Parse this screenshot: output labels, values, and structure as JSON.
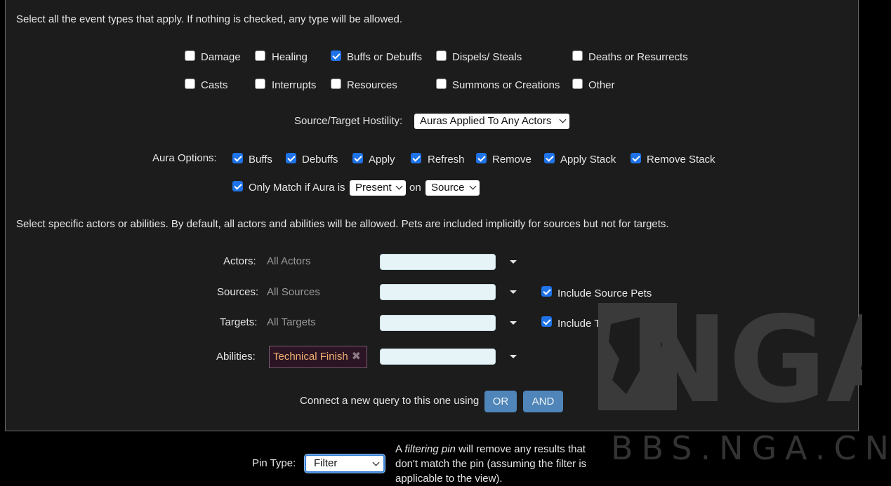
{
  "intro_text": "Select all the event types that apply. If nothing is checked, any type will be allowed.",
  "event_types": [
    {
      "label": "Damage",
      "checked": false
    },
    {
      "label": "Healing",
      "checked": false
    },
    {
      "label": "Buffs or Debuffs",
      "checked": true
    },
    {
      "label": "Dispels/ Steals",
      "checked": false
    },
    {
      "label": "Deaths or Resurrects",
      "checked": false
    },
    {
      "label": "Casts",
      "checked": false
    },
    {
      "label": "Interrupts",
      "checked": false
    },
    {
      "label": "Resources",
      "checked": false
    },
    {
      "label": "Summons or Creations",
      "checked": false
    },
    {
      "label": "Other",
      "checked": false
    }
  ],
  "hostility": {
    "label": "Source/Target Hostility:",
    "value": "Auras Applied To Any Actors"
  },
  "aura_options": {
    "label": "Aura Options:",
    "items": [
      {
        "label": "Buffs",
        "checked": true
      },
      {
        "label": "Debuffs",
        "checked": true
      },
      {
        "label": "Apply",
        "checked": true
      },
      {
        "label": "Refresh",
        "checked": true
      },
      {
        "label": "Remove",
        "checked": true
      },
      {
        "label": "Apply Stack",
        "checked": true
      },
      {
        "label": "Remove Stack",
        "checked": true
      }
    ],
    "match": {
      "label": "Only Match if Aura is",
      "checked": true,
      "presence_value": "Present",
      "on_label": "on",
      "target_value": "Source"
    }
  },
  "actors_intro": "Select specific actors or abilities. By default, all actors and abilities will be allowed. Pets are included implicitly for sources but not for targets.",
  "filters": {
    "actors": {
      "label": "Actors:",
      "value": "All Actors"
    },
    "sources": {
      "label": "Sources:",
      "value": "All Sources",
      "pets_label": "Include Source Pets",
      "pets_checked": true
    },
    "targets": {
      "label": "Targets:",
      "value": "All Targets",
      "pets_label": "Include Target Pets",
      "pets_checked": true
    },
    "abilities": {
      "label": "Abilities:",
      "tag": "Technical Finish",
      "tag_remove_icon": "✖"
    }
  },
  "connect": {
    "text": "Connect a new query to this one using",
    "or_label": "OR",
    "and_label": "AND"
  },
  "pin": {
    "label": "Pin Type:",
    "value": "Filter",
    "desc_prefix": "A ",
    "desc_em": "filtering pin",
    "desc_rest": " will remove any results that don't match the pin (assuming the filter is applicable to the view)."
  },
  "watermark": {
    "logo": "NGA",
    "url": "BBS.NGA.CN"
  },
  "colors": {
    "checkbox": "#1f73e8",
    "button": "#4f85b8",
    "tag_text": "#f0b070",
    "combo_bg": "#e6f4f7"
  }
}
